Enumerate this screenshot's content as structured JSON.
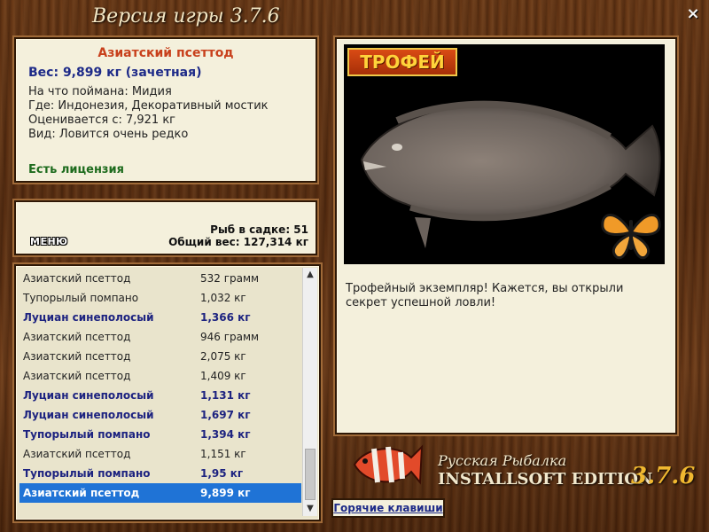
{
  "window": {
    "title": "Версия игры 3.7.6",
    "close_icon": "×"
  },
  "fish_info": {
    "title": "Азиатский псеттод",
    "weight": "Вес: 9,899 кг (зачетная)",
    "lines": [
      "На что поймана: Мидия",
      "Где: Индонезия, Декоративный мостик",
      "Оценивается с: 7,921 кг",
      "Вид: Ловится очень редко"
    ],
    "license": "Есть лицензия"
  },
  "cage": {
    "menu_label": "МЕНЮ",
    "fish_count": "Рыб в садке: 51",
    "total_weight": "Общий вес: 127,314 кг"
  },
  "catch_list": {
    "rows": [
      {
        "name": "Азиатский псеттод",
        "weight": "532 грамм",
        "bold": false,
        "selected": false
      },
      {
        "name": "Тупорылый помпано",
        "weight": "1,032 кг",
        "bold": false,
        "selected": false
      },
      {
        "name": "Луциан синеполосый",
        "weight": "1,366 кг",
        "bold": true,
        "selected": false
      },
      {
        "name": "Азиатский псеттод",
        "weight": "946 грамм",
        "bold": false,
        "selected": false
      },
      {
        "name": "Азиатский псеттод",
        "weight": "2,075 кг",
        "bold": false,
        "selected": false
      },
      {
        "name": "Азиатский псеттод",
        "weight": "1,409 кг",
        "bold": false,
        "selected": false
      },
      {
        "name": "Луциан синеполосый",
        "weight": "1,131 кг",
        "bold": true,
        "selected": false
      },
      {
        "name": "Луциан синеполосый",
        "weight": "1,697 кг",
        "bold": true,
        "selected": false
      },
      {
        "name": "Тупорылый помпано",
        "weight": "1,394 кг",
        "bold": true,
        "selected": false
      },
      {
        "name": "Азиатский псеттод",
        "weight": "1,151 кг",
        "bold": false,
        "selected": false
      },
      {
        "name": "Тупорылый помпано",
        "weight": "1,95 кг",
        "bold": true,
        "selected": false
      },
      {
        "name": "Азиатский псеттод",
        "weight": "9,899 кг",
        "bold": true,
        "selected": true
      }
    ]
  },
  "trophy": {
    "badge": "ТРОФЕЙ",
    "message": "Трофейный экземпляр! Кажется, вы открыли секрет успешной ловли!"
  },
  "branding": {
    "title": "Русская Рыбалка",
    "edition": "INSTALLSOFT EDITION",
    "version": "3.7.6"
  },
  "hotkeys_label": "Горячие клавиши",
  "colors": {
    "selection": "#1f73d6",
    "title_red": "#c8401c",
    "blue_text": "#1d2a88",
    "license_green": "#1d6b1d",
    "version_gold": "#f0b830"
  }
}
